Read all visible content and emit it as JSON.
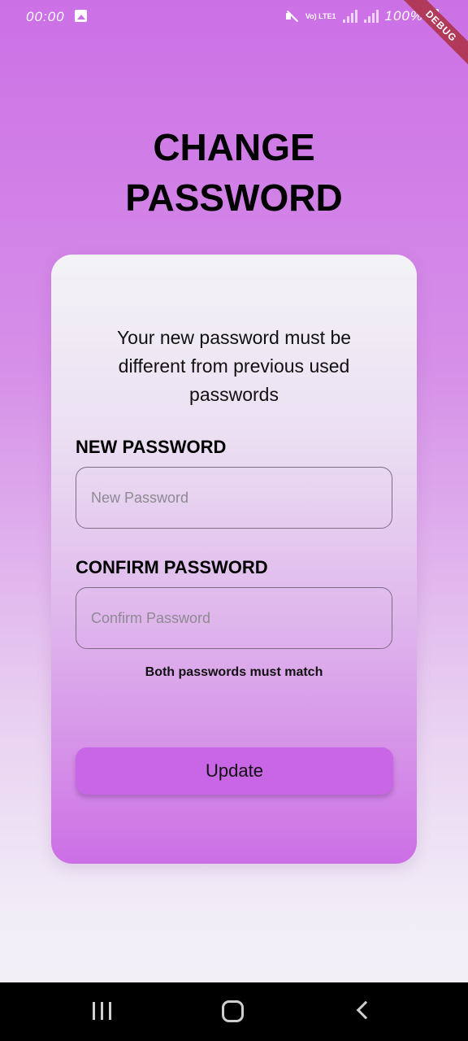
{
  "status_bar": {
    "time": "00:00",
    "network_label": "Vo) LTE1",
    "battery": "100%"
  },
  "debug_banner": "DEBUG",
  "page": {
    "title": "CHANGE PASSWORD"
  },
  "form": {
    "subtitle": "Your new password must be different from previous used passwords",
    "new_password": {
      "label": "NEW PASSWORD",
      "placeholder": "New Password",
      "value": ""
    },
    "confirm_password": {
      "label": "CONFIRM PASSWORD",
      "placeholder": "Confirm Password",
      "value": ""
    },
    "hint": "Both passwords must match",
    "submit_label": "Update"
  },
  "colors": {
    "accent": "#c866e6",
    "background_top": "#cc70e6",
    "background_bottom": "#f3f1f7",
    "debug_ribbon": "#b13a5a"
  },
  "icons": {
    "status_left": [
      "image-icon"
    ],
    "status_right": [
      "mute-icon",
      "signal-icon",
      "battery-icon"
    ],
    "nav": [
      "recents-icon",
      "home-icon",
      "back-icon"
    ]
  }
}
